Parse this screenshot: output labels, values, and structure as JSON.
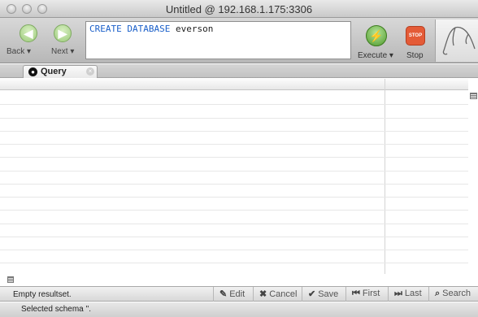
{
  "window": {
    "title": "Untitled @ 192.168.1.175:3306"
  },
  "toolbar": {
    "back_label": "Back ▾",
    "next_label": "Next ▾",
    "execute_label": "Execute ▾",
    "stop_label": "Stop",
    "stop_icon_text": "STOP"
  },
  "editor": {
    "keyword": "CREATE DATABASE",
    "identifier": "everson"
  },
  "tabs": [
    {
      "label": "Query"
    }
  ],
  "status": {
    "message": "Empty resultset."
  },
  "actions": {
    "edit": "Edit",
    "cancel": "Cancel",
    "save": "Save",
    "first": "First",
    "last": "Last",
    "search": "Search"
  },
  "schema_status": "Selected schema ''."
}
